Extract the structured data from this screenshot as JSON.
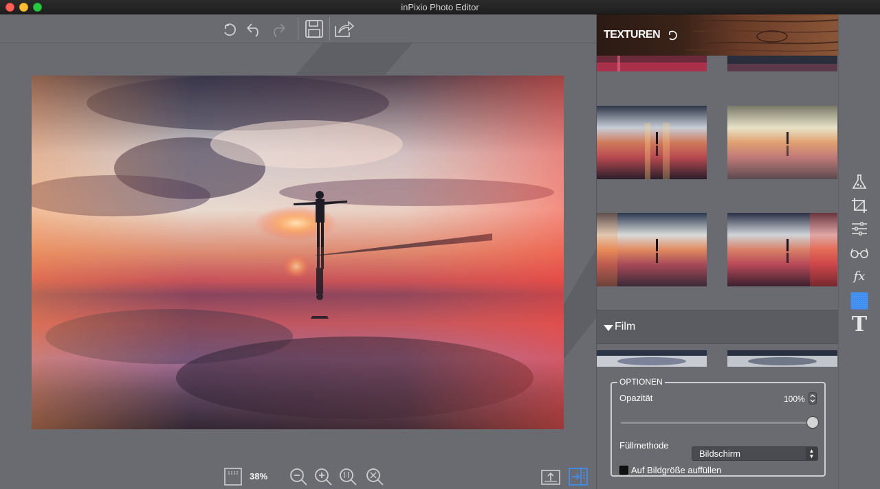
{
  "window": {
    "title": "inPixio Photo Editor"
  },
  "toolbar": {
    "buttons": [
      {
        "name": "reset-icon"
      },
      {
        "name": "undo-icon"
      },
      {
        "name": "redo-icon"
      },
      {
        "name": "save-icon"
      },
      {
        "name": "share-icon"
      }
    ]
  },
  "bottom": {
    "zoom_label": "38%",
    "buttons": [
      "fit-screen-icon",
      "zoom-out-icon",
      "zoom-in-icon",
      "actual-size-icon",
      "zoom-fit-icon",
      "upload-icon",
      "panel-toggle-icon"
    ]
  },
  "panel": {
    "header_title": "TEXTUREN",
    "section": {
      "label": "Film"
    },
    "options": {
      "title": "OPTIONEN",
      "opacity_label": "Opazität",
      "opacity_value": "100%",
      "opacity_level": 1.0,
      "blend_label": "Füllmethode",
      "blend_value": "Bildschirm",
      "fill_label": "Auf Bildgröße auffüllen",
      "fill_checked": false
    }
  },
  "tools": [
    "flask-icon",
    "crop-icon",
    "sliders-icon",
    "glasses-icon",
    "fx-icon",
    "texture-icon",
    "text-icon"
  ],
  "tool_labels": {
    "fx": "fx",
    "text": "T"
  },
  "colors": {
    "accent": "#3d8ef0",
    "panel_bg": "#6a6b70",
    "section_bg": "#5b5c61"
  }
}
